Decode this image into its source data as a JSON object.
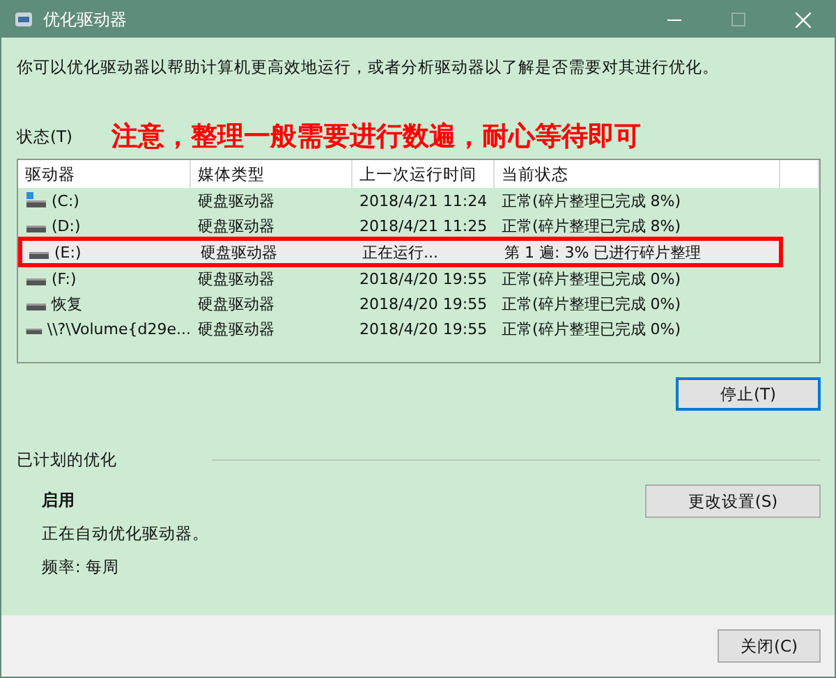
{
  "window": {
    "title": "优化驱动器"
  },
  "description": "你可以优化驱动器以帮助计算机更高效地运行，或者分析驱动器以了解是否需要对其进行优化。",
  "status_label": "状态(T)",
  "annotation": "注意，整理一般需要进行数遍，耐心等待即可",
  "table": {
    "columns": [
      "驱动器",
      "媒体类型",
      "上一次运行时间",
      "当前状态"
    ],
    "rows": [
      {
        "kind": "system",
        "drive": "(C:)",
        "media": "硬盘驱动器",
        "last_run": "2018/4/21 11:24",
        "status": "正常(碎片整理已完成 8%)",
        "selected": false,
        "outlined": false
      },
      {
        "kind": "drive",
        "drive": "(D:)",
        "media": "硬盘驱动器",
        "last_run": "2018/4/21 11:25",
        "status": "正常(碎片整理已完成 8%)",
        "selected": false,
        "outlined": false
      },
      {
        "kind": "drive",
        "drive": "(E:)",
        "media": "硬盘驱动器",
        "last_run": "正在运行...",
        "status": "第 1 遍: 3% 已进行碎片整理",
        "selected": true,
        "outlined": true
      },
      {
        "kind": "drive",
        "drive": "(F:)",
        "media": "硬盘驱动器",
        "last_run": "2018/4/20 19:55",
        "status": "正常(碎片整理已完成 0%)",
        "selected": false,
        "outlined": false
      },
      {
        "kind": "drive",
        "drive": "恢复",
        "media": "硬盘驱动器",
        "last_run": "2018/4/20 19:55",
        "status": "正常(碎片整理已完成 0%)",
        "selected": false,
        "outlined": false
      },
      {
        "kind": "drive",
        "drive": "\\\\?\\Volume{d29e...",
        "media": "硬盘驱动器",
        "last_run": "2018/4/20 19:55",
        "status": "正常(碎片整理已完成 0%)",
        "selected": false,
        "outlined": false
      }
    ]
  },
  "stop_button": "停止(T)",
  "scheduled": {
    "heading": "已计划的优化",
    "state": "启用",
    "note": "正在自动优化驱动器。",
    "frequency": "频率: 每周",
    "button": "更改设置(S)"
  },
  "close_button": "关闭(C)"
}
